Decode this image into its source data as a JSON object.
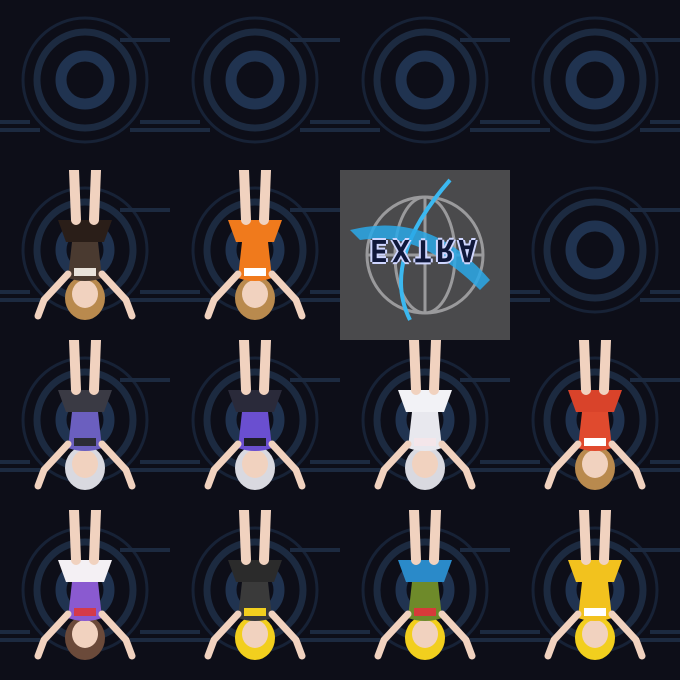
{
  "grid": {
    "title": "",
    "extra_label": "EXTRA",
    "tiles": [
      {
        "type": "locked",
        "icon": "ring-emblem-icon"
      },
      {
        "type": "locked",
        "icon": "ring-emblem-icon"
      },
      {
        "type": "locked",
        "icon": "ring-emblem-icon"
      },
      {
        "type": "locked",
        "icon": "ring-emblem-icon"
      },
      {
        "type": "costume",
        "hair": "#b98a4e",
        "top": "#4a3a30",
        "accent": "#e8e2da",
        "skirt": "#2a1e18"
      },
      {
        "type": "costume",
        "hair": "#b98a4e",
        "top": "#f07a1c",
        "accent": "#ffffff",
        "skirt": "#f07a1c"
      },
      {
        "type": "extra",
        "icon": "extra-emblem-icon"
      },
      {
        "type": "locked",
        "icon": "ring-emblem-icon"
      },
      {
        "type": "costume",
        "hair": "#d9d9e0",
        "top": "#6b5fbf",
        "accent": "#2c2c36",
        "skirt": "#3a3a44"
      },
      {
        "type": "costume",
        "hair": "#d9d9e0",
        "top": "#6a4fd0",
        "accent": "#1e1e28",
        "skirt": "#2a2a3a"
      },
      {
        "type": "costume",
        "hair": "#d9d9e0",
        "top": "#e8e8ee",
        "accent": "#f4e6ea",
        "skirt": "#f2f2f6"
      },
      {
        "type": "costume",
        "hair": "#b98a4e",
        "top": "#e04a2e",
        "accent": "#ffffff",
        "skirt": "#d9432a"
      },
      {
        "type": "costume",
        "hair": "#6b4a3a",
        "top": "#8a5ad0",
        "accent": "#d43a4a",
        "skirt": "#f4f0f4"
      },
      {
        "type": "costume",
        "hair": "#f2cf1e",
        "top": "#3a3a3a",
        "accent": "#f2cf1e",
        "skirt": "#2b2b2b"
      },
      {
        "type": "costume",
        "hair": "#f2cf1e",
        "top": "#6e8a2a",
        "accent": "#d73a3a",
        "skirt": "#2a8ac9"
      },
      {
        "type": "costume",
        "hair": "#f2cf1e",
        "top": "#f2c21e",
        "accent": "#ffffff",
        "skirt": "#f2c21e"
      }
    ]
  }
}
